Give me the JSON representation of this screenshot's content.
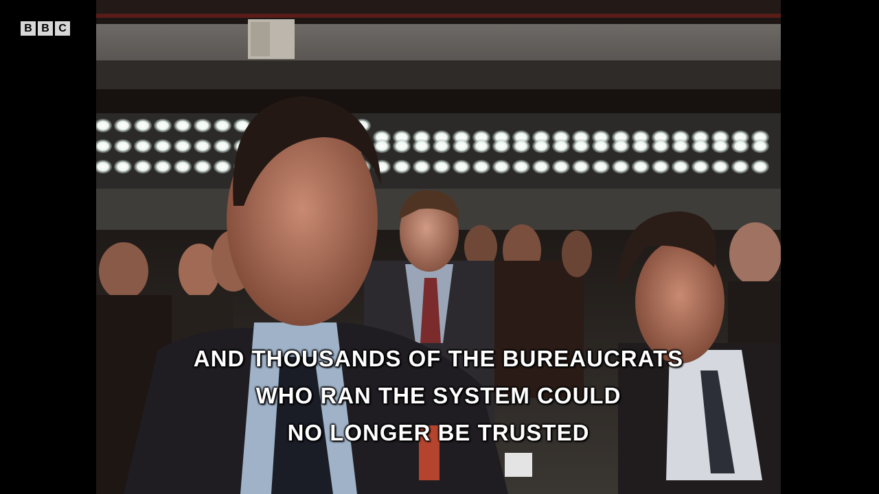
{
  "broadcaster": {
    "logo_letters": [
      "B",
      "B",
      "C"
    ]
  },
  "subtitles": {
    "lines": [
      "AND THOUSANDS OF THE BUREAUCRATS",
      "WHO RAN THE SYSTEM COULD",
      "NO LONGER BE TRUSTED"
    ],
    "color": "#ffffff"
  }
}
